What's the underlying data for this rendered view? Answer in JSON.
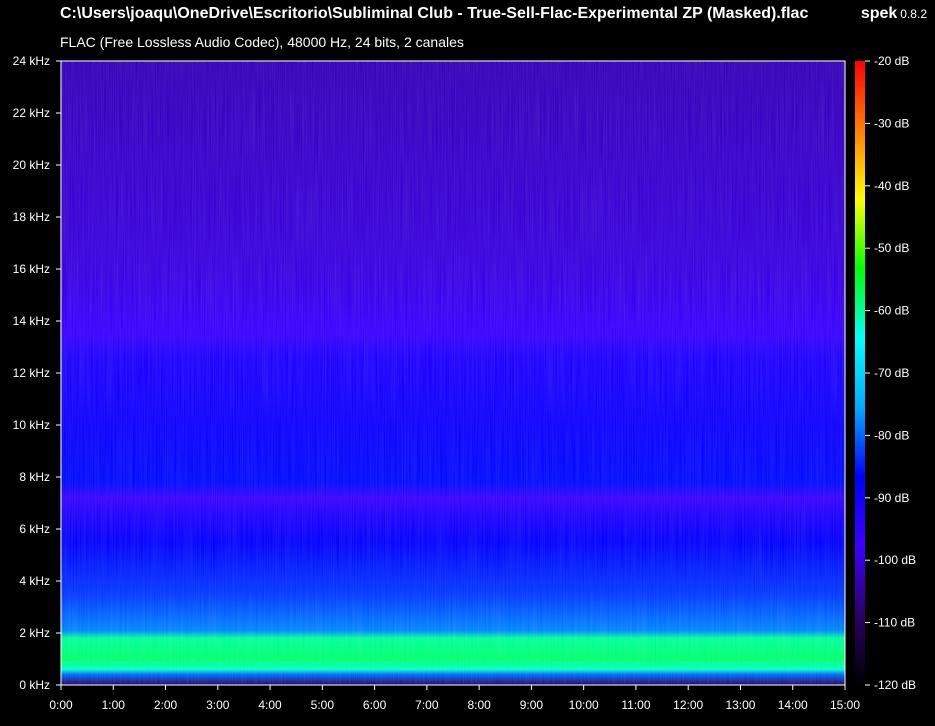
{
  "window": {
    "title": "C:\\Users\\joaqu\\OneDrive\\Escritorio\\Subliminal Club - True-Sell-Flac-Experimental ZP (Masked).flac",
    "subtitle": "FLAC (Free Lossless Audio Codec), 48000 Hz, 24 bits, 2 canales",
    "app_name": "spek",
    "app_version": "0.8.2"
  },
  "colors": {
    "background": "#000000",
    "text": "#ffffff"
  },
  "chart_data": {
    "type": "heatmap",
    "title": "",
    "xlabel": "",
    "ylabel": "",
    "x_ticks": [
      "0:00",
      "1:00",
      "2:00",
      "3:00",
      "4:00",
      "5:00",
      "6:00",
      "7:00",
      "8:00",
      "9:00",
      "10:00",
      "11:00",
      "12:00",
      "13:00",
      "14:00",
      "15:00"
    ],
    "y_ticks": [
      "0 kHz",
      "2 kHz",
      "4 kHz",
      "6 kHz",
      "8 kHz",
      "10 kHz",
      "12 kHz",
      "14 kHz",
      "16 kHz",
      "18 kHz",
      "20 kHz",
      "22 kHz",
      "24 kHz"
    ],
    "x_range_minutes": [
      0,
      15
    ],
    "y_range_khz": [
      0,
      24
    ],
    "db_ticks": [
      "-20 dB",
      "-30 dB",
      "-40 dB",
      "-50 dB",
      "-60 dB",
      "-70 dB",
      "-80 dB",
      "-90 dB",
      "-100 dB",
      "-110 dB",
      "-120 dB"
    ],
    "db_range": [
      -120,
      -20
    ],
    "colormap": [
      "#000000",
      "#2a0066",
      "#3b00ff",
      "#0000ff",
      "#00aaff",
      "#00ffff",
      "#00ff00",
      "#ffff00",
      "#ff8000",
      "#ff0000"
    ],
    "spectrum_profile": [
      {
        "khz": 0,
        "db": -110
      },
      {
        "khz": 0.4,
        "db": -80
      },
      {
        "khz": 0.6,
        "db": -62
      },
      {
        "khz": 1.0,
        "db": -58
      },
      {
        "khz": 1.8,
        "db": -60
      },
      {
        "khz": 2.1,
        "db": -78
      },
      {
        "khz": 3.5,
        "db": -83
      },
      {
        "khz": 5.5,
        "db": -87
      },
      {
        "khz": 6.5,
        "db": -92
      },
      {
        "khz": 7.2,
        "db": -97
      },
      {
        "khz": 7.8,
        "db": -86
      },
      {
        "khz": 10,
        "db": -89
      },
      {
        "khz": 12.5,
        "db": -92
      },
      {
        "khz": 13.5,
        "db": -97
      },
      {
        "khz": 16,
        "db": -100
      },
      {
        "khz": 24,
        "db": -103
      }
    ]
  }
}
